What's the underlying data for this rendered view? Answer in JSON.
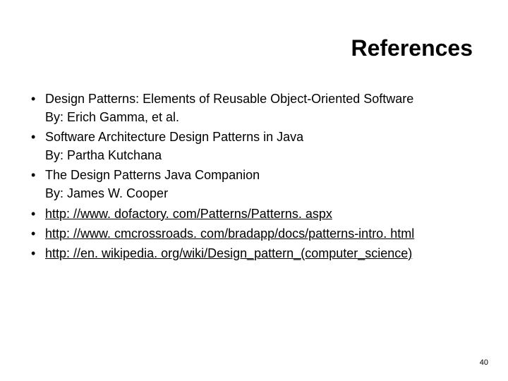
{
  "slide": {
    "title": "References",
    "items": [
      {
        "title": "Design Patterns: Elements of Reusable Object-Oriented Software",
        "byline": "By: Erich Gamma, et al."
      },
      {
        "title": "Software Architecture Design Patterns in Java",
        "byline": "By: Partha Kutchana"
      },
      {
        "title": "The Design Patterns Java Companion",
        "byline": "By: James W. Cooper"
      },
      {
        "link": "http: //www. dofactory. com/Patterns/Patterns. aspx"
      },
      {
        "link": "http: //www. cmcrossroads. com/bradapp/docs/patterns-intro. html"
      },
      {
        "link": "http: //en. wikipedia. org/wiki/Design_pattern_(computer_science)"
      }
    ],
    "page_number": "40"
  }
}
